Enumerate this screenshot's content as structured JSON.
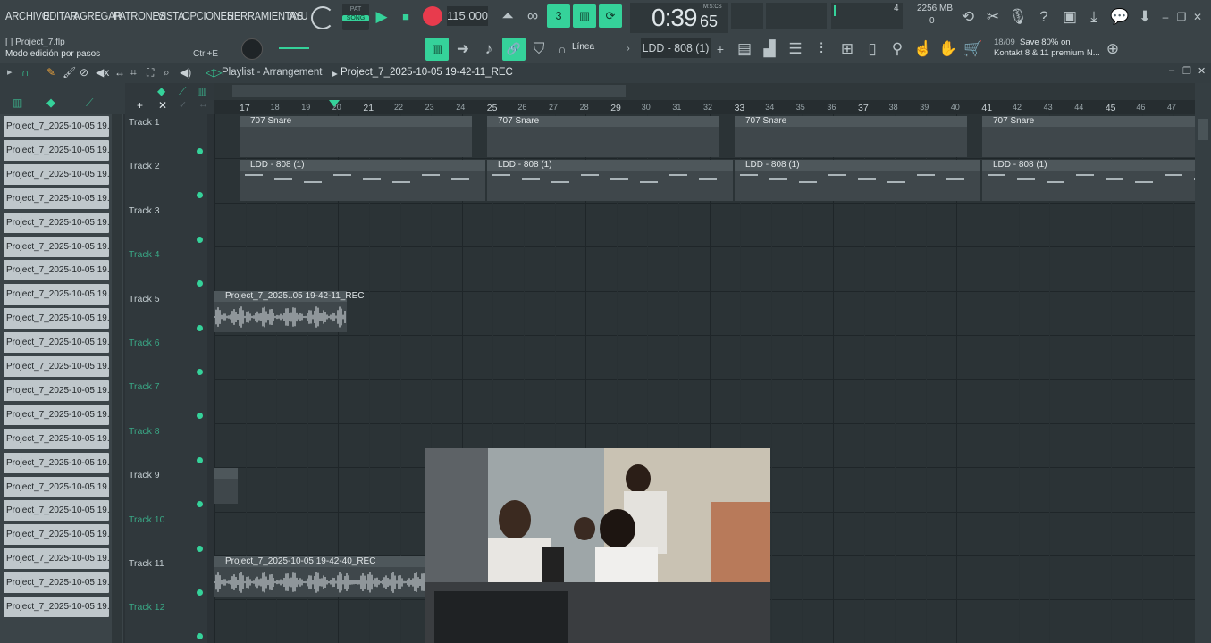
{
  "menu": [
    "ARCHIVO",
    "EDITAR",
    "AGREGAR",
    "PATRONES",
    "VISTA",
    "OPCIONES",
    "HERRAMIENTAS",
    "AYU"
  ],
  "transport": {
    "pat_label": "PAT",
    "song_label": "SONG",
    "tempo": "115.000",
    "time_main": "0:39",
    "time_sub": "65",
    "time_unit": "M:S:CS"
  },
  "cpu": {
    "top_value": "4",
    "memory": "2256 MB",
    "bottom_value": "0"
  },
  "project": {
    "filename": "[ ] Project_7.flp",
    "mode": "Modo edición por pasos",
    "shortcut": "Ctrl+E"
  },
  "snap": "Línea",
  "current_pattern": "LDD - 808 (1)",
  "news": {
    "date": "18/09",
    "line1": "Save 80% on",
    "line2": "Kontakt 8 & 11 premium N..."
  },
  "breadcrumb": {
    "section": "Playlist - Arrangement",
    "project": "Project_7_2025-10-05 19-42-11_REC"
  },
  "picker_items": [
    "Project_7_2025-10-05 19...",
    "Project_7_2025-10-05 19...",
    "Project_7_2025-10-05 19...",
    "Project_7_2025-10-05 19...",
    "Project_7_2025-10-05 19...",
    "Project_7_2025-10-05 19...",
    "Project_7_2025-10-05 19...",
    "Project_7_2025-10-05 19...",
    "Project_7_2025-10-05 19...",
    "Project_7_2025-10-05 19...",
    "Project_7_2025-10-05 19...",
    "Project_7_2025-10-05 19...",
    "Project_7_2025-10-05 19...",
    "Project_7_2025-10-05 19...",
    "Project_7_2025-10-05 19...",
    "Project_7_2025-10-05 19...",
    "Project_7_2025-10-05 19...",
    "Project_7_2025-10-05 19...",
    "Project_7_2025-10-05 19...",
    "Project_7_2025-10-05 19...",
    "Project_7_2025-10-05 19..."
  ],
  "tracks": [
    "Track 1",
    "Track 2",
    "Track 3",
    "Track 4",
    "Track 5",
    "Track 6",
    "Track 7",
    "Track 8",
    "Track 9",
    "Track 10",
    "Track 11",
    "Track 12"
  ],
  "ruler": [
    "17",
    "18",
    "19",
    "20",
    "21",
    "22",
    "23",
    "24",
    "25",
    "26",
    "27",
    "28",
    "29",
    "30",
    "31",
    "32",
    "33",
    "34",
    "35",
    "36",
    "37",
    "38",
    "39",
    "40",
    "41",
    "42",
    "43",
    "44",
    "45",
    "46",
    "47"
  ],
  "clips": {
    "snare": "707 Snare",
    "ldd": "LDD - 808 (1)",
    "rec1": "Project_7_2025..05 19-42-11_REC",
    "rec2": "Project_7_2025-10-05 19-42-40_REC"
  },
  "colors": {
    "accent": "#35d29a",
    "background": "#2b3236",
    "clip": "#4e575b"
  }
}
